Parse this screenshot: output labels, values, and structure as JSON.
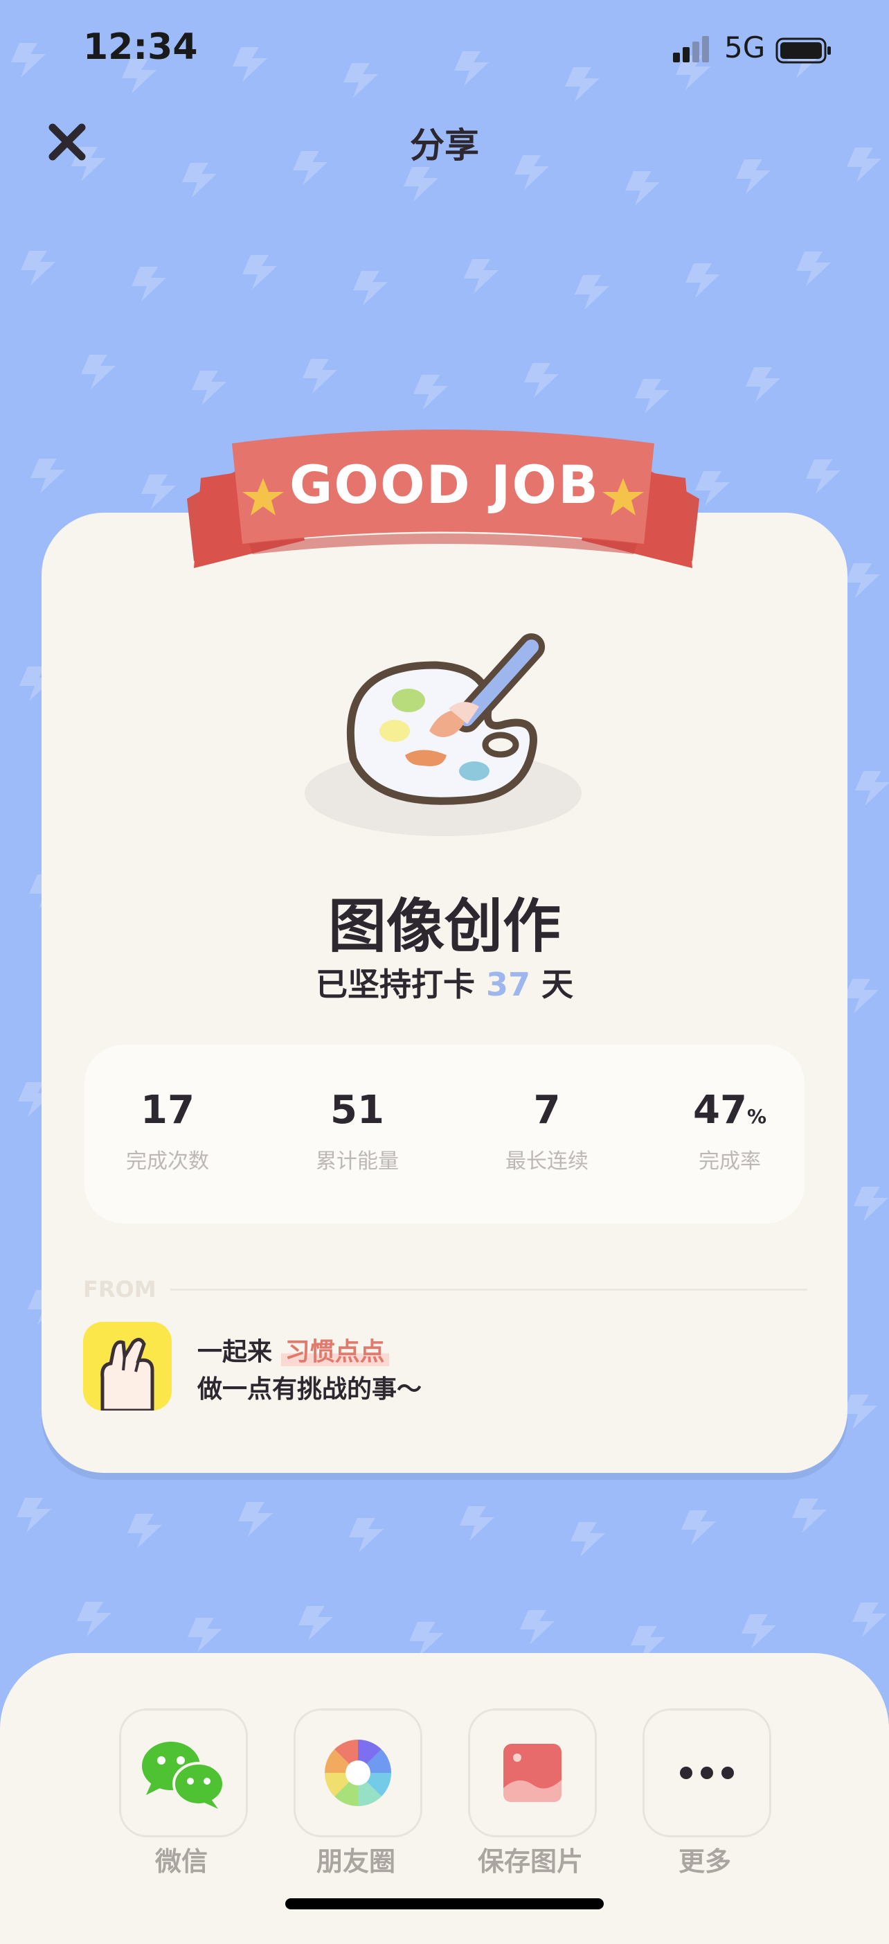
{
  "status": {
    "time": "12:34",
    "network": "5G"
  },
  "header": {
    "title": "分享"
  },
  "badge": {
    "text": "GOOD JOB"
  },
  "habit": {
    "name": "图像创作",
    "streak_prefix": "已坚持打卡",
    "streak_days": "37",
    "streak_suffix": "天"
  },
  "stats": [
    {
      "value": "17",
      "unit": "",
      "label": "完成次数"
    },
    {
      "value": "51",
      "unit": "",
      "label": "累计能量"
    },
    {
      "value": "7",
      "unit": "",
      "label": "最长连续"
    },
    {
      "value": "47",
      "unit": "%",
      "label": "完成率"
    }
  ],
  "from": {
    "label": "FROM",
    "slogan_prefix": "一起来",
    "app_name": "习惯点点",
    "slogan_line2": "做一点有挑战的事～"
  },
  "share": [
    {
      "label": "微信",
      "icon": "wechat-icon"
    },
    {
      "label": "朋友圈",
      "icon": "moments-icon"
    },
    {
      "label": "保存图片",
      "icon": "save-image-icon"
    },
    {
      "label": "更多",
      "icon": "more-icon"
    }
  ],
  "colors": {
    "background": "#9dbbf8",
    "card": "#f8f5ef",
    "ribbon": "#e4746c",
    "accent_number": "#9db6ee",
    "highlight": "#e07a6d"
  }
}
